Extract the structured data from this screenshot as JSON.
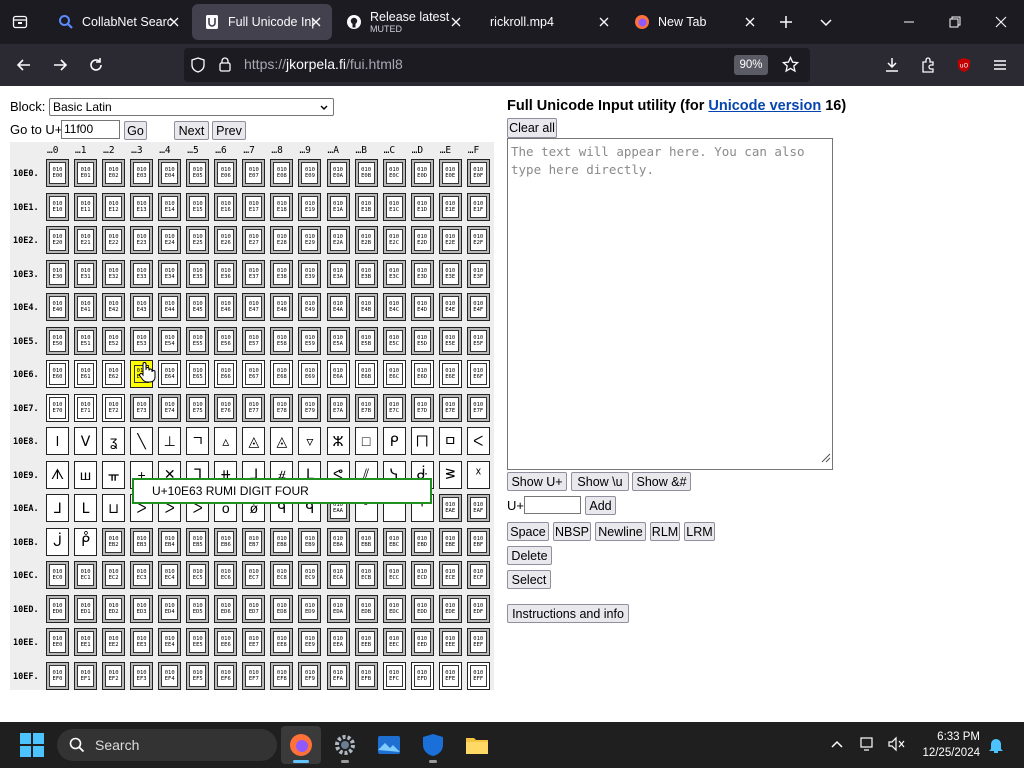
{
  "browser": {
    "tabs": [
      {
        "label": "CollabNet Search",
        "active": false
      },
      {
        "label": "Full Unicode Input",
        "active": true
      },
      {
        "label": "Release latest · s",
        "sublabel": "MUTED",
        "active": false
      },
      {
        "label": "rickroll.mp4",
        "active": false
      },
      {
        "label": "New Tab",
        "active": false
      }
    ],
    "url_prefix": "https://",
    "url_host": "jkorpela.fi",
    "url_path": "/fui.html8",
    "zoom": "90%"
  },
  "page": {
    "block_label": "Block:",
    "block_value": "Basic Latin",
    "goto_label": "Go to U+",
    "goto_value": "11f00",
    "go_button": "Go",
    "next_button": "Next",
    "prev_button": "Prev",
    "col_headers": [
      "…0",
      "…1",
      "…2",
      "…3",
      "…4",
      "…5",
      "…6",
      "…7",
      "…8",
      "…9",
      "…A",
      "…B",
      "…C",
      "…D",
      "…E",
      "…F"
    ],
    "row_headers": [
      "10E0.",
      "10E1.",
      "10E2.",
      "10E3.",
      "10E4.",
      "10E5.",
      "10E6.",
      "10E7.",
      "10E8.",
      "10E9.",
      "10EA.",
      "10EB.",
      "10EC.",
      "10ED.",
      "10EE.",
      "10EF."
    ],
    "rows": [
      [
        "010E00",
        "010E01",
        "010E02",
        "010E03",
        "010E04",
        "010E05",
        "010E06",
        "010E07",
        "010E08",
        "010E09",
        "010E0A",
        "010E0B",
        "010E0C",
        "010E0D",
        "010E0E",
        "010E0F"
      ],
      [
        "010E10",
        "010E11",
        "010E12",
        "010E13",
        "010E14",
        "010E15",
        "010E16",
        "010E17",
        "010E18",
        "010E19",
        "010E1A",
        "010E1B",
        "010E1C",
        "010E1D",
        "010E1E",
        "010E1F"
      ],
      [
        "010E20",
        "010E21",
        "010E22",
        "010E23",
        "010E24",
        "010E25",
        "010E26",
        "010E27",
        "010E28",
        "010E29",
        "010E2A",
        "010E2B",
        "010E2C",
        "010E2D",
        "010E2E",
        "010E2F"
      ],
      [
        "010E30",
        "010E31",
        "010E32",
        "010E33",
        "010E34",
        "010E35",
        "010E36",
        "010E37",
        "010E38",
        "010E39",
        "010E3A",
        "010E3B",
        "010E3C",
        "010E3D",
        "010E3E",
        "010E3F"
      ],
      [
        "010E40",
        "010E41",
        "010E42",
        "010E43",
        "010E44",
        "010E45",
        "010E46",
        "010E47",
        "010E48",
        "010E49",
        "010E4A",
        "010E4B",
        "010E4C",
        "010E4D",
        "010E4E",
        "010E4F"
      ],
      [
        "010E50",
        "010E51",
        "010E52",
        "010E53",
        "010E54",
        "010E55",
        "010E56",
        "010E57",
        "010E58",
        "010E59",
        "010E5A",
        "010E5B",
        "010E5C",
        "010E5D",
        "010E5E",
        "010E5F"
      ],
      [
        "010E60",
        "010E61",
        "010E62",
        "010E63",
        "010E64",
        "010E65",
        "010E66",
        "010E67",
        "010E68",
        "010E69",
        "010E6A",
        "010E6B",
        "010E6C",
        "010E6D",
        "010E6E",
        "010E6F"
      ],
      [
        "010E70",
        "010E71",
        "010E72",
        "010E73",
        "010E74",
        "010E75",
        "010E76",
        "010E77",
        "010E78",
        "010E79",
        "010E7A",
        "010E7B",
        "010E7C",
        "010E7D",
        "010E7E",
        "010E7F"
      ],
      [
        "ǀ",
        "ᐯ",
        "ʓ",
        "╲",
        "⊥",
        "ㄱ",
        "▵",
        "◬",
        "◬",
        "▿",
        "ⵣ",
        "□",
        "ᑭ",
        "ㄇ",
        "ㅁ",
        "ᐸ"
      ],
      [
        "ᗑ",
        "ш",
        "ᚂ",
        "+",
        "✕",
        "ᒣ",
        "⧺",
        "ᒧ",
        "⧣",
        "ᒪ",
        "ᕙ",
        "⫽",
        "ᓭ",
        "ᑽ",
        "ᕒ",
        "ᕁ"
      ],
      [
        "ᒧ",
        "ᒪ",
        "⊔",
        "ᐳ",
        "ᐳ",
        "ᐳ",
        "o",
        "ǿ",
        "ᑫ",
        "ᑫ",
        "010EAA",
        "˚",
        "¯",
        "ʹ",
        "010EAE",
        "010EAF"
      ],
      [
        "ᒎ",
        "ᑬ",
        "010EB2",
        "010EB3",
        "010EB4",
        "010EB5",
        "010EB6",
        "010EB7",
        "010EB8",
        "010EB9",
        "010EBA",
        "010EBB",
        "010EBC",
        "010EBD",
        "010EBE",
        "010EBF"
      ],
      [
        "010EC0",
        "010EC1",
        "010EC2",
        "010EC3",
        "010EC4",
        "010EC5",
        "010EC6",
        "010EC7",
        "010EC8",
        "010EC9",
        "010ECA",
        "010ECB",
        "010ECC",
        "010ECD",
        "010ECE",
        "010ECF"
      ],
      [
        "010ED0",
        "010ED1",
        "010ED2",
        "010ED3",
        "010ED4",
        "010ED5",
        "010ED6",
        "010ED7",
        "010ED8",
        "010ED9",
        "010EDA",
        "010EDB",
        "010EDC",
        "010EDD",
        "010EDE",
        "010EDF"
      ],
      [
        "010EE0",
        "010EE1",
        "010EE2",
        "010EE3",
        "010EE4",
        "010EE5",
        "010EE6",
        "010EE7",
        "010EE8",
        "010EE9",
        "010EEA",
        "010EEB",
        "010EEC",
        "010EED",
        "010EEE",
        "010EEF"
      ],
      [
        "010EF0",
        "010EF1",
        "010EF2",
        "010EF3",
        "010EF4",
        "010EF5",
        "010EF6",
        "010EF7",
        "010EF8",
        "010EF9",
        "010EFA",
        "010EFB",
        "010EFC",
        "010EFD",
        "010EFE",
        "010EFF"
      ]
    ],
    "tooltip": "U+10E63 RUMI DIGIT FOUR",
    "title_prefix": "Full Unicode Input utility (for ",
    "title_link": "Unicode version",
    "title_suffix": " 16)",
    "clear_all": "Clear all",
    "textarea_placeholder": "The text will appear here. You can also type here directly.",
    "show_u": "Show U+",
    "show_backslash": "Show \\u",
    "show_entity": "Show &#",
    "uplus_label": "U+",
    "add_button": "Add",
    "space_button": "Space",
    "nbsp_button": "NBSP",
    "newline_button": "Newline",
    "rlm_button": "RLM",
    "lrm_button": "LRM",
    "delete_button": "Delete",
    "select_button": "Select",
    "instructions_button": "Instructions and info"
  },
  "taskbar": {
    "search_placeholder": "Search",
    "time": "6:33 PM",
    "date": "12/25/2024"
  },
  "colors": {
    "tab_bg": "#1c1b22",
    "nav_bg": "#2b2a33",
    "highlight": "#ffff00",
    "tooltip_border": "#1f8f1f",
    "link": "#0645ad"
  }
}
